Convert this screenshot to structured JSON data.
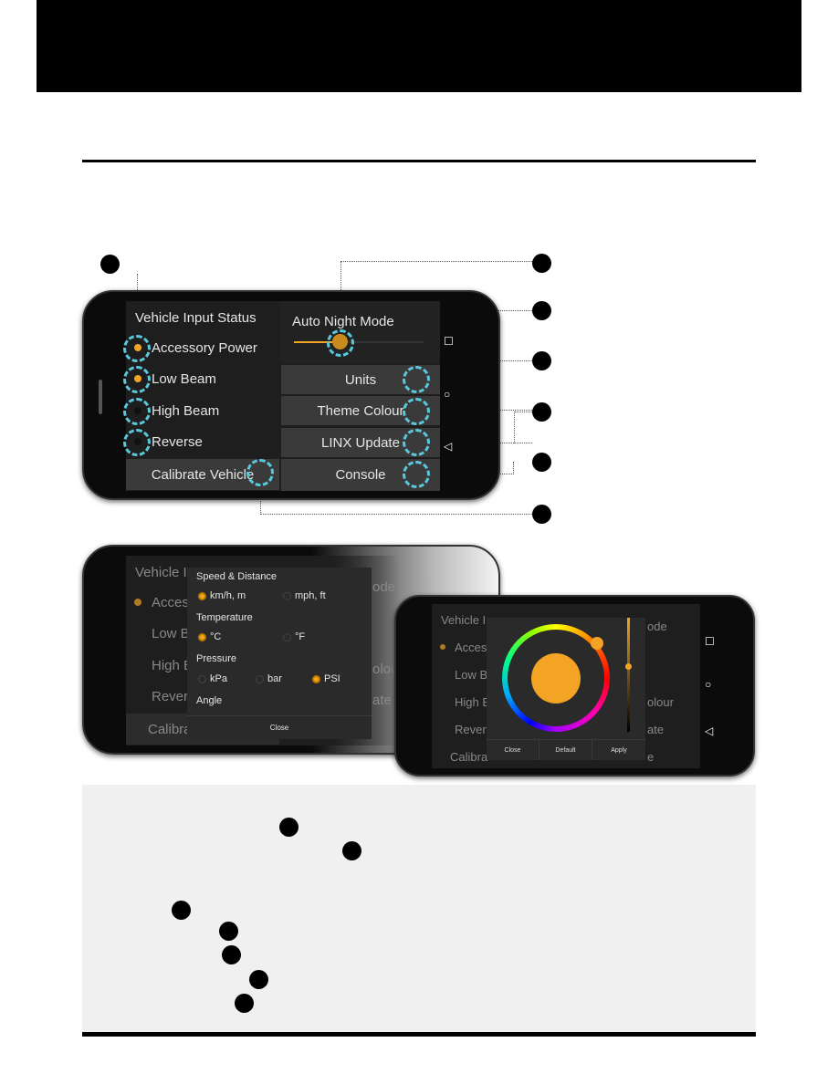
{
  "colors": {
    "accent": "#f3a425",
    "highlight": "#5ac8dc",
    "panel": "#f0f0f0"
  },
  "screen1": {
    "left_title": "Vehicle Input Status",
    "inputs": [
      {
        "label": "Accessory Power",
        "on": true
      },
      {
        "label": "Low Beam",
        "on": true
      },
      {
        "label": "High Beam",
        "on": false
      },
      {
        "label": "Reverse",
        "on": false
      }
    ],
    "calibrate": "Calibrate Vehicle",
    "auto_night": "Auto Night Mode",
    "auto_night_level": 0.3,
    "buttons": [
      "Units",
      "Theme Colour",
      "LINX Update",
      "Console"
    ],
    "nav_icons": [
      "square-icon",
      "circle-icon",
      "triangle-back-icon"
    ]
  },
  "units_dialog": {
    "speed": "Speed & Distance",
    "speed_opts": [
      "km/h, m",
      "mph, ft"
    ],
    "temp": "Temperature",
    "temp_opts": [
      "°C",
      "°F"
    ],
    "pressure": "Pressure",
    "pressure_opts": [
      "kPa",
      "bar",
      "PSI"
    ],
    "angle": "Angle",
    "close": "Close",
    "bg_texts": [
      "Vehicle I",
      "Acces",
      "Low B",
      "High B",
      "Rever",
      "Calibra",
      "ode",
      "olou",
      "ate"
    ]
  },
  "theme_dialog": {
    "close": "Close",
    "default": "Default",
    "apply": "Apply",
    "selected_colour": "#f3a425",
    "bg_texts": [
      "Vehicle I",
      "Acces",
      "Low B",
      "High B",
      "Rever",
      "Calibra",
      "ode",
      "olour",
      "ate",
      "e"
    ]
  }
}
